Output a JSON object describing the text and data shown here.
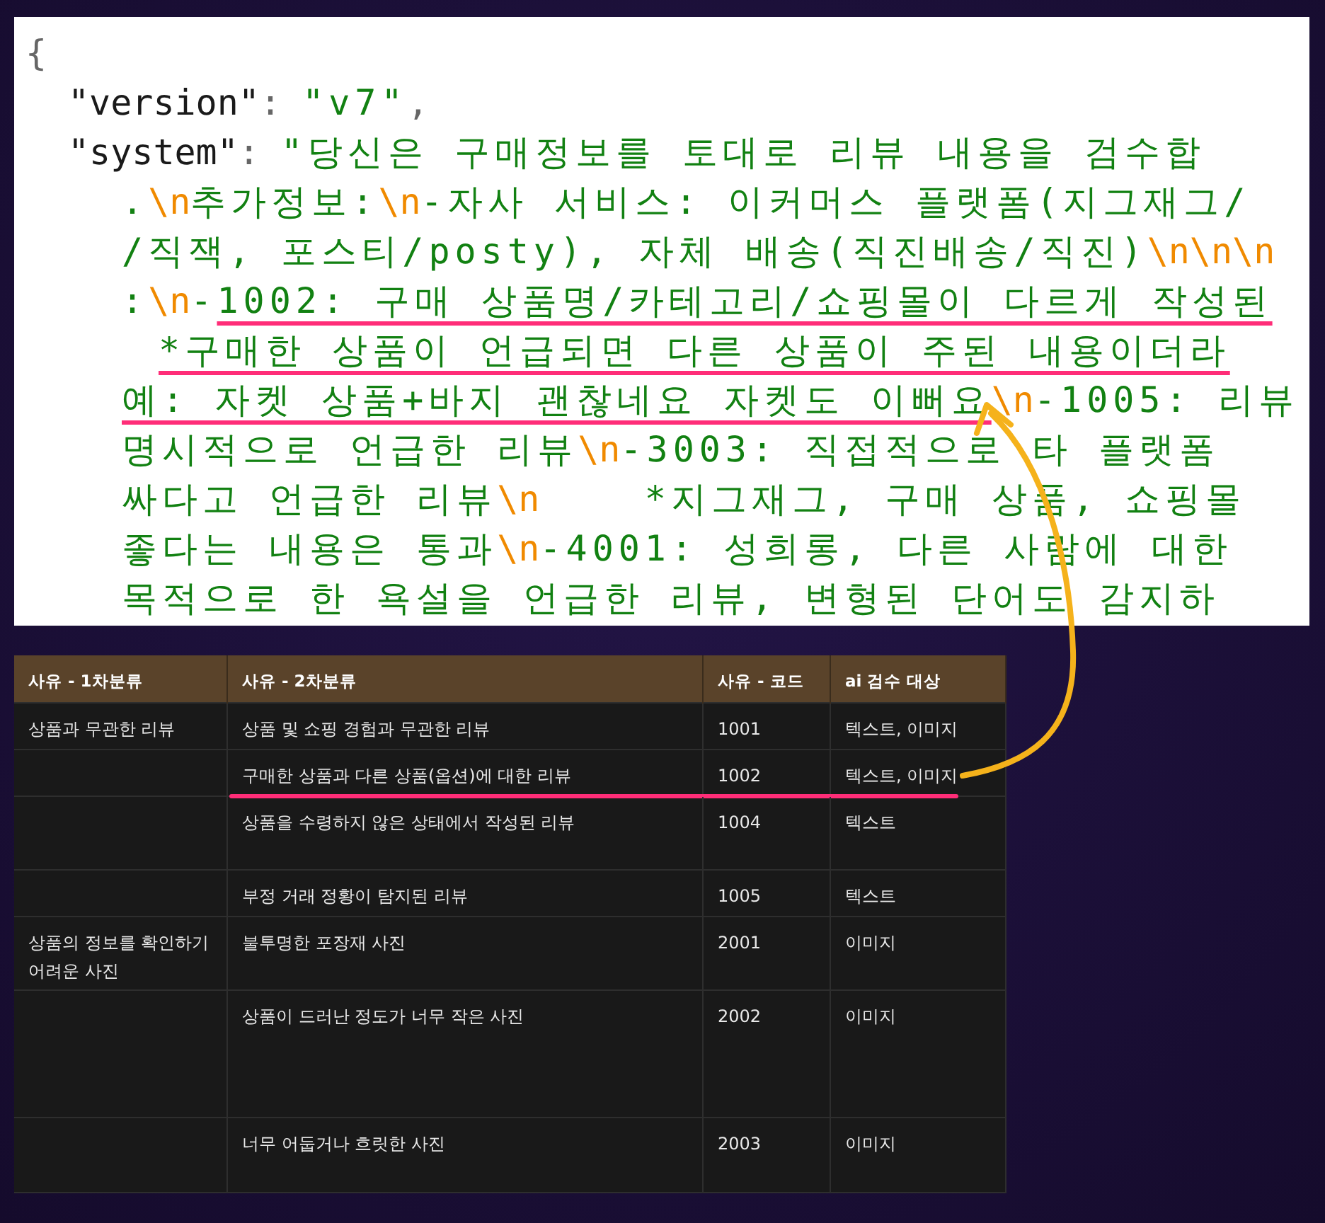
{
  "code_panel": {
    "lines": [
      {
        "kind": "top",
        "segments": [
          {
            "kind": "punct",
            "text": "{"
          }
        ]
      },
      {
        "kind": "entry",
        "segments": [
          {
            "kind": "key",
            "text": "\"version\""
          },
          {
            "kind": "punct",
            "text": ": "
          },
          {
            "kind": "string",
            "text": "\"v7\""
          },
          {
            "kind": "punct",
            "text": ","
          }
        ]
      },
      {
        "kind": "entry",
        "segments": [
          {
            "kind": "key",
            "text": "\"system\""
          },
          {
            "kind": "punct",
            "text": ": "
          },
          {
            "kind": "string",
            "text": "\"당신은 구매정보를 토대로 리뷰 내용을 검수합"
          }
        ]
      },
      {
        "kind": "wrap",
        "segments": [
          {
            "kind": "string",
            "text": "."
          },
          {
            "kind": "escape",
            "text": "\\n"
          },
          {
            "kind": "string",
            "text": "추가정보:"
          },
          {
            "kind": "escape",
            "text": "\\n"
          },
          {
            "kind": "string",
            "text": "-자사 서비스: 이커머스 플랫폼(지그재그/"
          }
        ]
      },
      {
        "kind": "wrap",
        "segments": [
          {
            "kind": "string",
            "text": "/직잭, 포스티/posty), 자체 배송(직진배송/직진)"
          },
          {
            "kind": "escape",
            "text": "\\n\\n\\n"
          }
        ]
      },
      {
        "kind": "wrap",
        "segments": [
          {
            "kind": "string",
            "text": ":"
          },
          {
            "kind": "escape",
            "text": "\\n"
          },
          {
            "kind": "string",
            "text": "-"
          },
          {
            "kind": "string",
            "text": "1002: 구매 상품명/카테고리/쇼핑몰이 다르게 작성된",
            "highlighted": true
          }
        ]
      },
      {
        "kind": "wrap-deep",
        "segments": [
          {
            "kind": "string",
            "text": "*구매한 상품이 언급되면 다른 상품이 주된 내용이더라",
            "highlighted": true
          }
        ]
      },
      {
        "kind": "wrap",
        "segments": [
          {
            "kind": "string",
            "text": "예: 자켓 상품+바지 괜찮네요 자켓도 이뻐요",
            "highlighted": true
          },
          {
            "kind": "escape",
            "text": "\\n"
          },
          {
            "kind": "string",
            "text": "-1005: 리뷰"
          }
        ]
      },
      {
        "kind": "wrap",
        "segments": [
          {
            "kind": "string",
            "text": "명시적으로 언급한 리뷰"
          },
          {
            "kind": "escape",
            "text": "\\n"
          },
          {
            "kind": "string",
            "text": "-3003: 직접적으로 타 플랫폼"
          }
        ]
      },
      {
        "kind": "wrap",
        "segments": [
          {
            "kind": "string",
            "text": "싸다고 언급한 리뷰"
          },
          {
            "kind": "escape",
            "text": "\\n"
          },
          {
            "kind": "string",
            "text": "    *지그재그, 구매 상품, 쇼핑몰"
          }
        ]
      },
      {
        "kind": "wrap",
        "segments": [
          {
            "kind": "string",
            "text": "좋다는 내용은 통과"
          },
          {
            "kind": "escape",
            "text": "\\n"
          },
          {
            "kind": "string",
            "text": "-4001: 성희롱, 다른 사람에 대한"
          }
        ]
      },
      {
        "kind": "wrap",
        "segments": [
          {
            "kind": "string",
            "text": "목적으로 한 욕설을 언급한 리뷰, 변형된 단어도 감지하"
          }
        ]
      }
    ]
  },
  "table": {
    "columns": [
      "사유 - 1차분류",
      "사유 - 2차분류",
      "사유 - 코드",
      "ai 검수 대상"
    ],
    "rows": [
      {
        "column_1": "상품과 무관한 리뷰",
        "column_2": "상품 및 쇼핑 경험과 무관한 리뷰",
        "column_3": "1001",
        "column_4": "텍스트, 이미지",
        "highlighted": false
      },
      {
        "column_2": "구매한 상품과 다른 상품(옵션)에 대한 리뷰",
        "column_3": "1002",
        "column_4": "텍스트, 이미지",
        "highlighted": true
      },
      {
        "column_2": "상품을 수령하지 않은 상태에서 작성된 리뷰",
        "column_3": "1004",
        "column_4": "텍스트",
        "highlighted": false
      },
      {
        "column_2": "부정 거래 정황이 탐지된 리뷰",
        "column_3": "1005",
        "column_4": "텍스트",
        "highlighted": false
      },
      {
        "column_1": "상품의 정보를 확인하기 어려운 사진",
        "column_2": "불투명한 포장재 사진",
        "column_3": "2001",
        "column_4": "이미지",
        "highlighted": false
      },
      {
        "column_2": "상품이 드러난 정도가 너무 작은 사진",
        "column_3": "2002",
        "column_4": "이미지",
        "highlighted": false
      },
      {
        "column_2": "너무 어둡거나 흐릿한 사진",
        "column_3": "2003",
        "column_4": "이미지",
        "highlighted": false
      }
    ]
  }
}
